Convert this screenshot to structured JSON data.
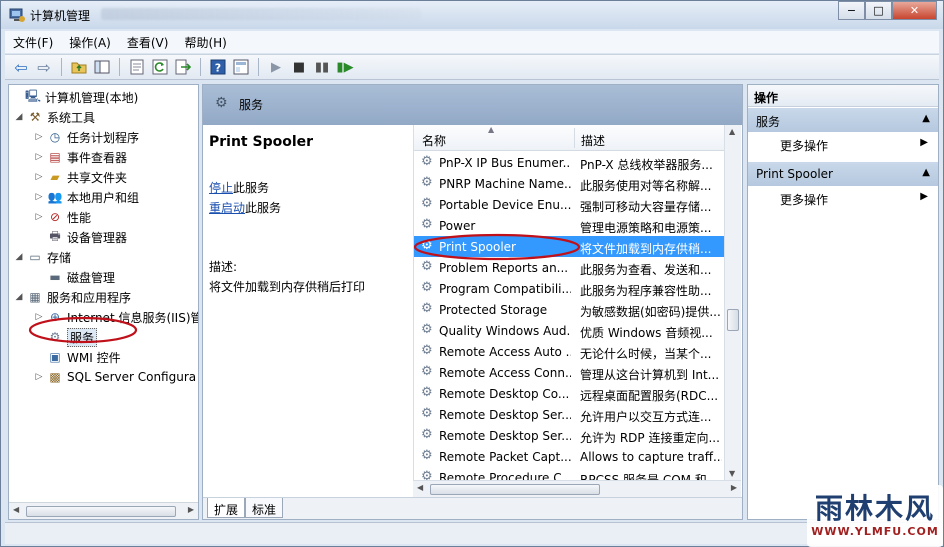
{
  "window": {
    "title": "计算机管理",
    "caption_buttons": {
      "minimize": "−",
      "maximize": "□",
      "close": "✕"
    }
  },
  "menu": [
    "文件(F)",
    "操作(A)",
    "查看(V)",
    "帮助(H)"
  ],
  "toolbar_icons": [
    "back-arrow-icon",
    "forward-arrow-icon",
    "up-folder-icon",
    "show-tree-icon",
    "properties-icon",
    "refresh-icon",
    "export-icon",
    "help-icon",
    "console-icon",
    "play-icon",
    "stop-icon",
    "pause-icon",
    "restart-icon"
  ],
  "tree": [
    {
      "label": "计算机管理(本地)",
      "icon": "computer-icon",
      "toggle": ""
    },
    {
      "label": "系统工具",
      "icon": "tools-icon",
      "toggle": "◢"
    },
    {
      "label": "任务计划程序",
      "icon": "clock-icon",
      "toggle": "▷"
    },
    {
      "label": "事件查看器",
      "icon": "event-viewer-icon",
      "toggle": "▷"
    },
    {
      "label": "共享文件夹",
      "icon": "shared-folder-icon",
      "toggle": "▷"
    },
    {
      "label": "本地用户和组",
      "icon": "users-icon",
      "toggle": "▷"
    },
    {
      "label": "性能",
      "icon": "performance-icon",
      "toggle": "▷"
    },
    {
      "label": "设备管理器",
      "icon": "device-manager-icon",
      "toggle": ""
    },
    {
      "label": "存储",
      "icon": "storage-icon",
      "toggle": "◢"
    },
    {
      "label": "磁盘管理",
      "icon": "disk-icon",
      "toggle": ""
    },
    {
      "label": "服务和应用程序",
      "icon": "services-apps-icon",
      "toggle": "◢"
    },
    {
      "label": "Internet 信息服务(IIS)管",
      "icon": "iis-icon",
      "toggle": "▷"
    },
    {
      "label": "服务",
      "icon": "gear-icon",
      "toggle": ""
    },
    {
      "label": "WMI 控件",
      "icon": "wmi-icon",
      "toggle": ""
    },
    {
      "label": "SQL Server Configura",
      "icon": "sql-icon",
      "toggle": "▷"
    }
  ],
  "center": {
    "header": "服务",
    "selected_service": "Print Spooler",
    "stop_link": "停止",
    "stop_suffix": "此服务",
    "restart_link": "重启动",
    "restart_suffix": "此服务",
    "desc_label": "描述:",
    "desc_text": "将文件加载到内存供稍后打印",
    "columns": {
      "name": "名称",
      "desc": "描述"
    },
    "services": [
      {
        "name": "PnP-X IP Bus Enumer...",
        "desc": "PnP-X 总线枚举器服务..."
      },
      {
        "name": "PNRP Machine Name...",
        "desc": "此服务使用对等名称解..."
      },
      {
        "name": "Portable Device Enu...",
        "desc": "强制可移动大容量存储..."
      },
      {
        "name": "Power",
        "desc": "管理电源策略和电源策..."
      },
      {
        "name": "Print Spooler",
        "desc": "将文件加载到内存供稍..."
      },
      {
        "name": "Problem Reports an...",
        "desc": "此服务为查看、发送和..."
      },
      {
        "name": "Program Compatibili...",
        "desc": "此服务为程序兼容性助..."
      },
      {
        "name": "Protected Storage",
        "desc": "为敏感数据(如密码)提供..."
      },
      {
        "name": "Quality Windows Aud...",
        "desc": "优质 Windows 音频视..."
      },
      {
        "name": "Remote Access Auto ...",
        "desc": "无论什么时候，当某个..."
      },
      {
        "name": "Remote Access Conn...",
        "desc": "管理从这台计算机到 Int..."
      },
      {
        "name": "Remote Desktop Co...",
        "desc": "远程桌面配置服务(RDC..."
      },
      {
        "name": "Remote Desktop Ser...",
        "desc": "允许用户以交互方式连..."
      },
      {
        "name": "Remote Desktop Ser...",
        "desc": "允许为 RDP 连接重定向..."
      },
      {
        "name": "Remote Packet Capt...",
        "desc": "Allows to capture traff..."
      },
      {
        "name": "Remote Procedure C...",
        "desc": "RPCSS 服务是 COM 和..."
      }
    ],
    "tabs": [
      "扩展",
      "标准"
    ]
  },
  "actions": {
    "title": "操作",
    "sections": [
      {
        "label": "服务",
        "items": [
          "更多操作"
        ]
      },
      {
        "label": "Print Spooler",
        "items": [
          "更多操作"
        ]
      }
    ]
  },
  "watermark": {
    "big": "雨林木风",
    "small": "WWW.YLMFU.COM"
  }
}
